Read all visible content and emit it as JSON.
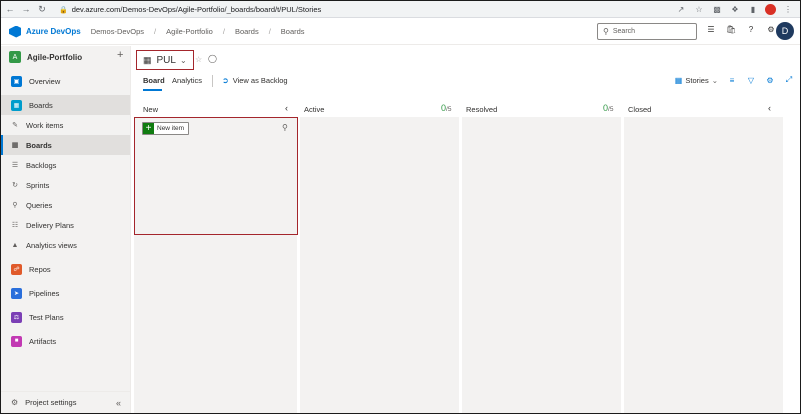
{
  "browser": {
    "url": "dev.azure.com/Demos-DevOps/Agile-Portfolio/_boards/board/t/PUL/Stories",
    "profile_initial": ""
  },
  "header": {
    "brand": "Azure DevOps",
    "breadcrumbs": [
      "Demos-DevOps",
      "Agile-Portfolio",
      "Boards",
      "Boards"
    ],
    "search_placeholder": "Search",
    "avatar_initial": "D"
  },
  "sidebar": {
    "project_initial": "A",
    "project_name": "Agile-Portfolio",
    "items": [
      {
        "label": "Overview"
      },
      {
        "label": "Boards"
      },
      {
        "label": "Work items"
      },
      {
        "label": "Boards"
      },
      {
        "label": "Backlogs"
      },
      {
        "label": "Sprints"
      },
      {
        "label": "Queries"
      },
      {
        "label": "Delivery Plans"
      },
      {
        "label": "Analytics views"
      },
      {
        "label": "Repos"
      },
      {
        "label": "Pipelines"
      },
      {
        "label": "Test Plans"
      },
      {
        "label": "Artifacts"
      }
    ],
    "footer_label": "Project settings"
  },
  "main": {
    "board_name": "PUL",
    "tabs": [
      {
        "label": "Board"
      },
      {
        "label": "Analytics"
      }
    ],
    "view_backlog": "View as Backlog",
    "level_picker": "Stories",
    "columns": [
      {
        "title": "New"
      },
      {
        "title": "Active",
        "count": "0",
        "limit": "/5"
      },
      {
        "title": "Resolved",
        "count": "0",
        "limit": "/5"
      },
      {
        "title": "Closed"
      }
    ],
    "new_item_label": "New item"
  },
  "colors": {
    "accent": "#0078d4",
    "highlight": "#a4262c",
    "new_item_green": "#107c10"
  }
}
